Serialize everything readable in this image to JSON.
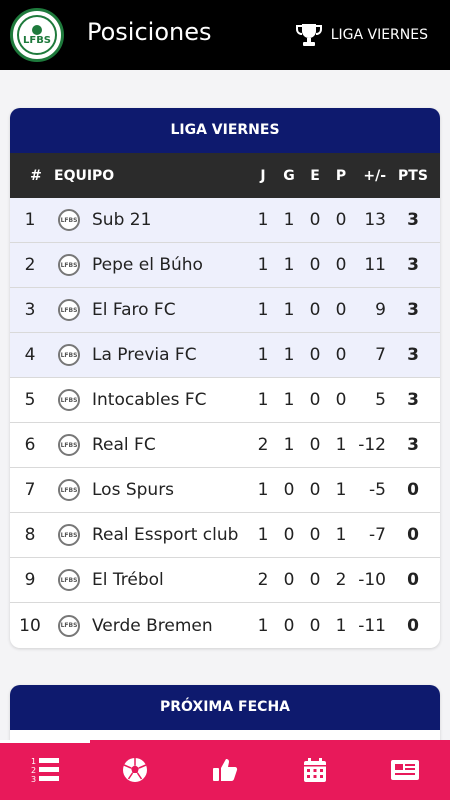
{
  "header": {
    "title": "Posiciones",
    "league_selector": "LIGA VIERNES",
    "logo_text": "LFBS"
  },
  "standings": {
    "title": "LIGA VIERNES",
    "columns": [
      "#",
      "EQUIPO",
      "J",
      "G",
      "E",
      "P",
      "+/-",
      "PTS"
    ],
    "rows": [
      {
        "pos": "1",
        "team": "Sub 21",
        "j": "1",
        "g": "1",
        "e": "0",
        "p": "0",
        "dif": "13",
        "pts": "3"
      },
      {
        "pos": "2",
        "team": "Pepe el Búho",
        "j": "1",
        "g": "1",
        "e": "0",
        "p": "0",
        "dif": "11",
        "pts": "3"
      },
      {
        "pos": "3",
        "team": "El Faro FC",
        "j": "1",
        "g": "1",
        "e": "0",
        "p": "0",
        "dif": "9",
        "pts": "3"
      },
      {
        "pos": "4",
        "team": "La Previa FC",
        "j": "1",
        "g": "1",
        "e": "0",
        "p": "0",
        "dif": "7",
        "pts": "3"
      },
      {
        "pos": "5",
        "team": "Intocables FC",
        "j": "1",
        "g": "1",
        "e": "0",
        "p": "0",
        "dif": "5",
        "pts": "3"
      },
      {
        "pos": "6",
        "team": "Real FC",
        "j": "2",
        "g": "1",
        "e": "0",
        "p": "1",
        "dif": "-12",
        "pts": "3"
      },
      {
        "pos": "7",
        "team": "Los Spurs",
        "j": "1",
        "g": "0",
        "e": "0",
        "p": "1",
        "dif": "-5",
        "pts": "0"
      },
      {
        "pos": "8",
        "team": "Real Essport club",
        "j": "1",
        "g": "0",
        "e": "0",
        "p": "1",
        "dif": "-7",
        "pts": "0"
      },
      {
        "pos": "9",
        "team": "El Trébol",
        "j": "2",
        "g": "0",
        "e": "0",
        "p": "2",
        "dif": "-10",
        "pts": "0"
      },
      {
        "pos": "10",
        "team": "Verde Bremen",
        "j": "1",
        "g": "0",
        "e": "0",
        "p": "1",
        "dif": "-11",
        "pts": "0"
      }
    ]
  },
  "next_match": {
    "title": "PRÓXIMA FECHA"
  },
  "bottom_nav": {
    "items": [
      {
        "icon": "standings-list-icon",
        "active": true
      },
      {
        "icon": "soccer-ball-icon",
        "active": false
      },
      {
        "icon": "thumbs-up-icon",
        "active": false
      },
      {
        "icon": "calendar-icon",
        "active": false
      },
      {
        "icon": "news-icon",
        "active": false
      }
    ]
  },
  "colors": {
    "topbar": "#000000",
    "card_header": "#0e1a6e",
    "table_header": "#2b2b2b",
    "highlight_row": "#eef0fc",
    "bottom_nav": "#e8195a",
    "logo_green": "#1e7a3c"
  }
}
